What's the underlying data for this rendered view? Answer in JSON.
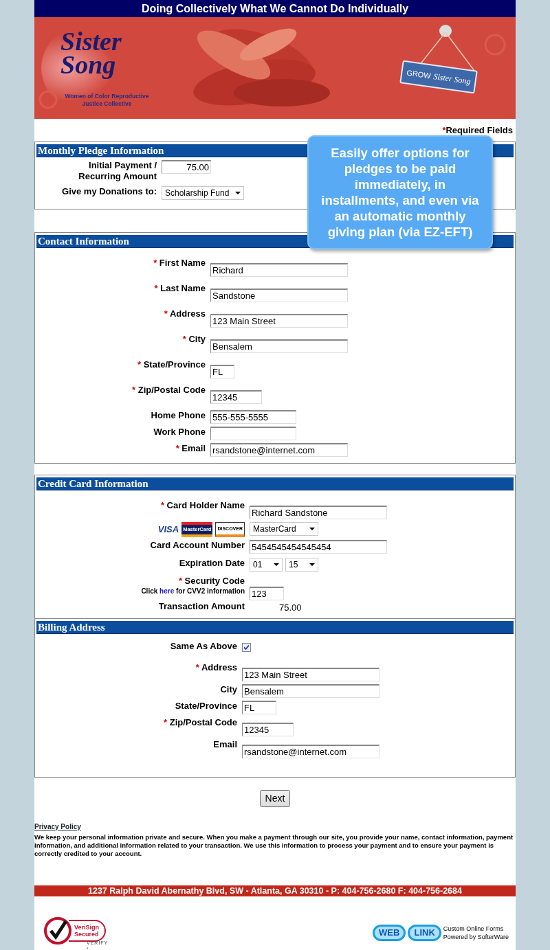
{
  "header": {
    "tagline": "Doing Collectively What We Cannot Do Individually"
  },
  "banner": {
    "logo_lines": [
      "Sister",
      "Song"
    ],
    "logo_subtitle": "Women of Color Reproductive Justice Collective",
    "sign_word": "GROW",
    "sign_logo": "Sister Song"
  },
  "required_mark": "*",
  "required_note": "Required Fields",
  "callout": "Easily offer options for pledges to be paid immediately, in installments, and even via an automatic monthly giving plan (via EZ-EFT)",
  "sections": [
    {
      "title": "Monthly Pledge Information",
      "rows": [
        {
          "kind": "text",
          "label": "Initial Payment / Recurring Amount",
          "required": false,
          "value": "75.00"
        },
        {
          "kind": "select",
          "label": "Give my Donations to:",
          "required": false,
          "value": "Scholarship Fund"
        }
      ]
    },
    {
      "title": "Contact Information",
      "rows": [
        {
          "kind": "text",
          "label": "First Name",
          "required": true,
          "value": "Richard"
        },
        {
          "kind": "text",
          "label": "Last Name",
          "required": true,
          "value": "Sandstone"
        },
        {
          "kind": "text",
          "label": "Address",
          "required": true,
          "value": "123 Main Street"
        },
        {
          "kind": "text",
          "label": "City",
          "required": true,
          "value": "Bensalem"
        },
        {
          "kind": "text",
          "label": "State/Province",
          "required": true,
          "value": "FL"
        },
        {
          "kind": "text",
          "label": "Zip/Postal Code",
          "required": true,
          "value": "12345"
        },
        {
          "kind": "text",
          "label": "Home Phone",
          "required": false,
          "value": "555-555-5555"
        },
        {
          "kind": "text",
          "label": "Work Phone",
          "required": false
        },
        {
          "kind": "text",
          "label": "Email",
          "required": true,
          "value": "rsandstone@internet.com"
        }
      ]
    },
    {
      "title": "Credit Card Information",
      "rows": [
        {
          "kind": "text",
          "label": "Card Holder Name",
          "required": true,
          "value": "Richard Sandstone"
        },
        {
          "kind": "cards",
          "cards": [
            "VISA",
            "MasterCard",
            "DISCOVER"
          ],
          "value": "MasterCard"
        },
        {
          "kind": "text",
          "label": "Card Account Number",
          "required": false,
          "value": "5454545454545454"
        },
        {
          "kind": "dates",
          "label": "Expiration Date",
          "required": false,
          "values": [
            "01",
            "15"
          ]
        },
        {
          "kind": "text",
          "label": "Security Code",
          "required": true,
          "hint_parts": [
            "Click",
            "here",
            "for CVV2 information"
          ],
          "value": "123"
        },
        {
          "kind": "value",
          "label": "Transaction Amount",
          "required": false,
          "value": "75.00"
        }
      ]
    },
    {
      "title": "Billing Address",
      "rows": [
        {
          "kind": "checkbox",
          "label": "Same As Above",
          "required": false,
          "checked": true
        },
        {
          "kind": "text",
          "label": "Address",
          "required": true,
          "value": "123 Main Street"
        },
        {
          "kind": "text",
          "label": "City",
          "required": false,
          "value": "Bensalem"
        },
        {
          "kind": "text",
          "label": "State/Province",
          "required": false,
          "value": "FL"
        },
        {
          "kind": "text",
          "label": "Zip/Postal Code",
          "required": true,
          "value": "12345"
        },
        {
          "kind": "text",
          "label": "Email",
          "required": false,
          "value": "rsandstone@internet.com"
        }
      ]
    }
  ],
  "next_button": "Next",
  "privacy": {
    "title": "Privacy Policy",
    "text": "We keep your personal information private and secure. When you make a payment through our site, you provide your name, contact information, payment information, and additional information related to your transaction. We use this information to process your payment and to ensure your payment is correctly credited to your account."
  },
  "address_bar": "1237 Ralph David Abernathy Blvd, SW - Atlanta, GA 30310 - P: 404-756-2680 F: 404-756-2684",
  "verisign": {
    "lines": [
      "VeriSign",
      "Secured"
    ],
    "verify": "VERIFY ›"
  },
  "weblink": {
    "parts": [
      "WEB",
      "LINK"
    ],
    "lines": [
      "Custom Online Forms",
      "Powered by SofterWare"
    ]
  }
}
